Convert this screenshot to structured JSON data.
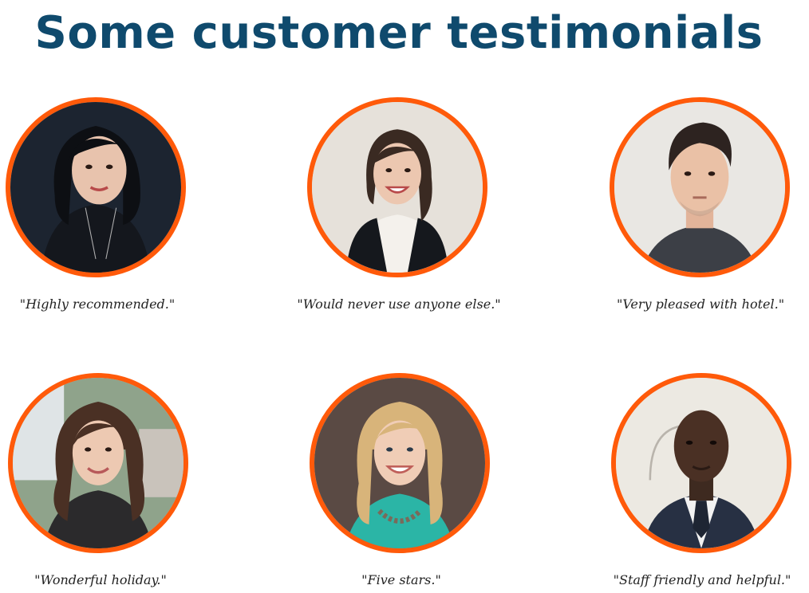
{
  "page": {
    "title": "Some customer testimonials"
  },
  "colors": {
    "title": "#0f4a6d",
    "ring": "#ff5a0a"
  },
  "testimonials": [
    {
      "quote": "\"Highly recommended.\"",
      "photo": "woman-black-hair-portrait"
    },
    {
      "quote": "\"Would never use anyone else.\"",
      "photo": "woman-dark-hair-vest-portrait"
    },
    {
      "quote": "\"Very pleased with hotel.\"",
      "photo": "man-short-hair-portrait"
    },
    {
      "quote": "\"Wonderful holiday.\"",
      "photo": "woman-brown-hair-portrait"
    },
    {
      "quote": "\"Five stars.\"",
      "photo": "woman-blonde-hair-portrait"
    },
    {
      "quote": "\"Staff friendly and helpful.\"",
      "photo": "man-suit-portrait"
    }
  ]
}
